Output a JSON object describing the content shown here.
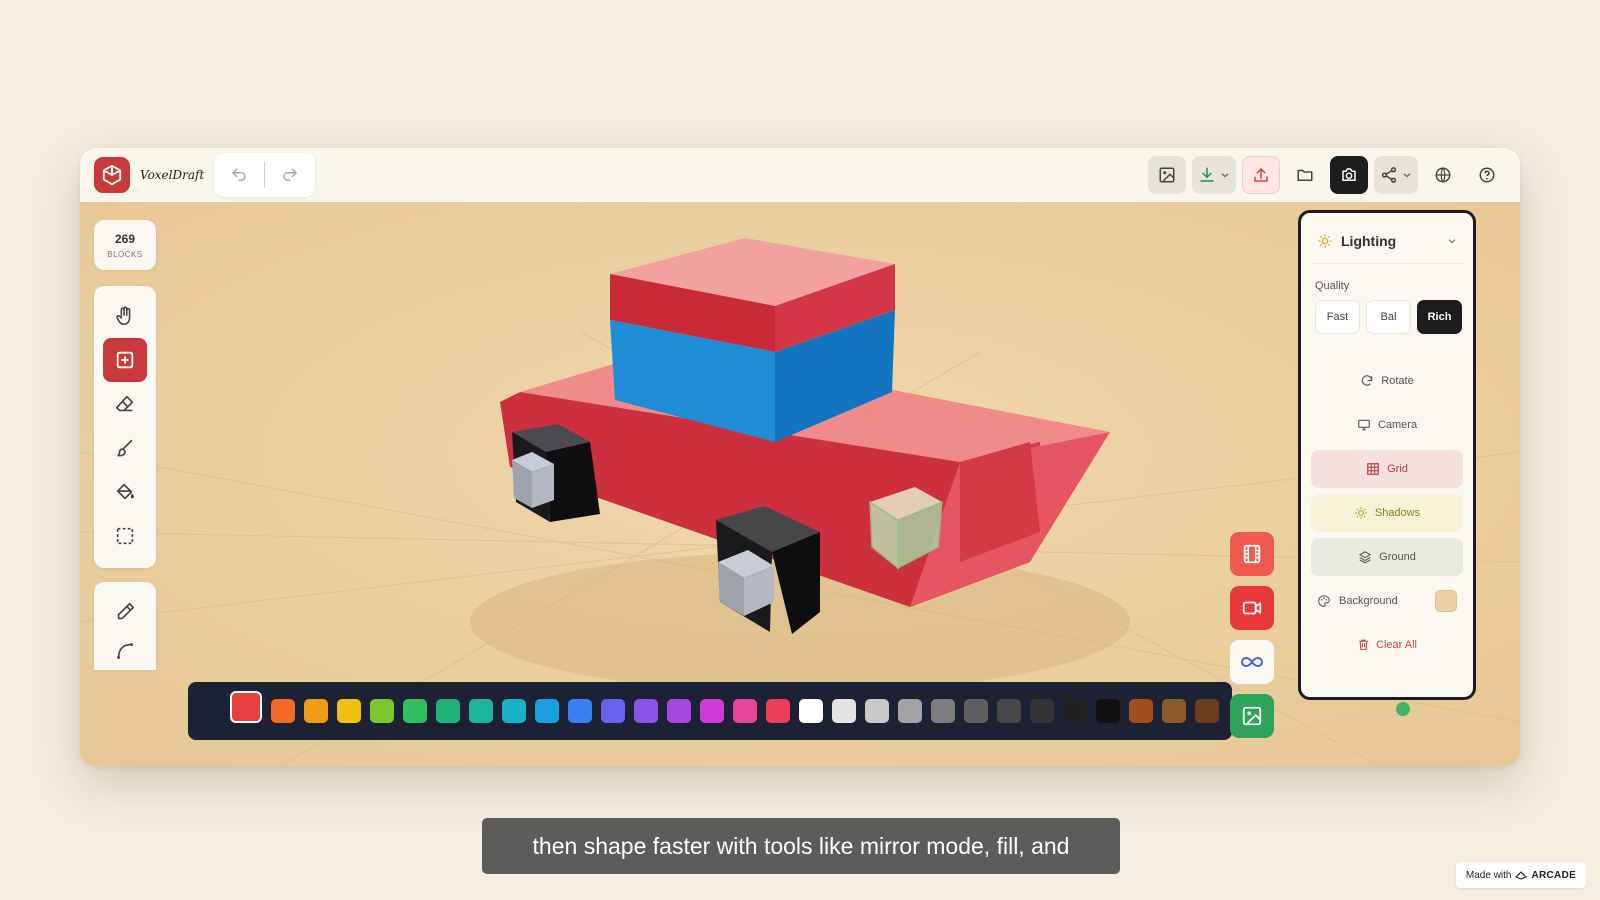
{
  "app": {
    "name": "VoxelDraft"
  },
  "stats": {
    "block_count": "269",
    "block_label": "BLOCKS"
  },
  "panel": {
    "title": "Lighting",
    "quality_label": "Quality",
    "quality_options": [
      "Fast",
      "Bal",
      "Rich"
    ],
    "quality_selected": "Rich",
    "buttons": {
      "rotate": "Rotate",
      "camera": "Camera",
      "grid": "Grid",
      "shadows": "Shadows",
      "ground": "Ground"
    },
    "background_label": "Background",
    "background_color": "#ecd2a3",
    "clear_all": "Clear All"
  },
  "palette": {
    "current_color": "#e84040",
    "selected_color": "#e84040",
    "colors": [
      "#e84040",
      "#f26a24",
      "#f39b16",
      "#f2c00d",
      "#7ac72e",
      "#2fbf5d",
      "#20b47d",
      "#1db59a",
      "#16b1c6",
      "#1aa0e0",
      "#3880ef",
      "#6860ee",
      "#8b52e8",
      "#a846e0",
      "#d03bd6",
      "#e8449a",
      "#ec3e5c",
      "#ffffff",
      "#e4e4e4",
      "#c9c9c9",
      "#a3a3a3",
      "#7d7d7d",
      "#5e5e5e",
      "#474747",
      "#333333",
      "#202020",
      "#111111",
      "#a44e1c",
      "#8b5a2b",
      "#6b3e1b"
    ]
  },
  "caption": "then shape faster with tools like mirror mode, fill, and",
  "badge": {
    "prefix": "Made with",
    "brand": "ARCADE"
  },
  "colors": {
    "accent": "#c93a3a",
    "dark": "#1d1d1d",
    "canvas": "#ecd2a3"
  }
}
